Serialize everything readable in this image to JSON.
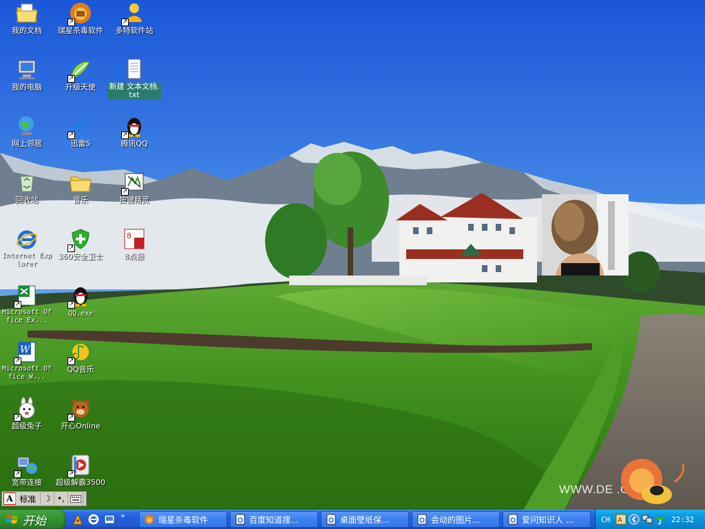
{
  "desktop": {
    "icons": [
      {
        "label": "我的文档",
        "icon": "my-documents-folder"
      },
      {
        "label": "瑞星杀毒软件",
        "icon": "rising-antivirus-lion"
      },
      {
        "label": "多特软件站",
        "icon": "duote-site-person"
      },
      {
        "label": "我的电脑",
        "icon": "my-computer"
      },
      {
        "label": "升级天使",
        "icon": "upgrade-angel"
      },
      {
        "label": "新建 文本文档.txt",
        "icon": "text-document"
      },
      {
        "label": "网上邻居",
        "icon": "network-places"
      },
      {
        "label": "迅雷5",
        "icon": "thunder-download"
      },
      {
        "label": "腾讯QQ",
        "icon": "qq-penguin"
      },
      {
        "label": "回收站",
        "icon": "recycle-bin"
      },
      {
        "label": "音乐",
        "icon": "music-folder"
      },
      {
        "label": "按键精灵",
        "icon": "key-wizard"
      },
      {
        "label": "Internet Explorer",
        "icon": "internet-explorer"
      },
      {
        "label": "360安全卫士",
        "icon": "360-safe-shield"
      },
      {
        "label": "8点报",
        "icon": "8dianbao"
      },
      {
        "label": "Microsoft Office Ex...",
        "icon": "excel"
      },
      {
        "label": "QQ.exe",
        "icon": "qq-penguin"
      },
      {
        "label": "Microsoft Office W...",
        "icon": "word"
      },
      {
        "label": "QQ音乐",
        "icon": "qq-music"
      },
      {
        "label": "超级兔子",
        "icon": "super-rabbit"
      },
      {
        "label": "开心Online",
        "icon": "kaixin-bear"
      },
      {
        "label": "宽带连接",
        "icon": "broadband-connection"
      },
      {
        "label": "超级解霸3500",
        "icon": "super-jieba-player"
      }
    ],
    "watermark": "WWW.DE    .ORG"
  },
  "ime": {
    "logo": "A",
    "mode": "标准",
    "moon": "☽",
    "punct": "•,",
    "keyboard": "keyboard-icon"
  },
  "taskbar": {
    "start_label": "开始",
    "quick_launch": [
      "ql-app-icon",
      "ie-icon",
      "show-desktop-icon"
    ],
    "more": "»",
    "tasks": [
      {
        "label": "瑞星杀毒软件"
      },
      {
        "label": "百度知道搜..."
      },
      {
        "label": "桌面壁纸保..."
      },
      {
        "label": "会动的图片..."
      },
      {
        "label": "爱问知识人 ..."
      }
    ],
    "tray": {
      "lang": "CH",
      "clock": "22:32"
    }
  },
  "colors": {
    "taskbar_blue": "#245edb",
    "start_green": "#3c9e39",
    "tray_blue": "#0b8bd6",
    "selected_label": "#2a7a6e"
  }
}
